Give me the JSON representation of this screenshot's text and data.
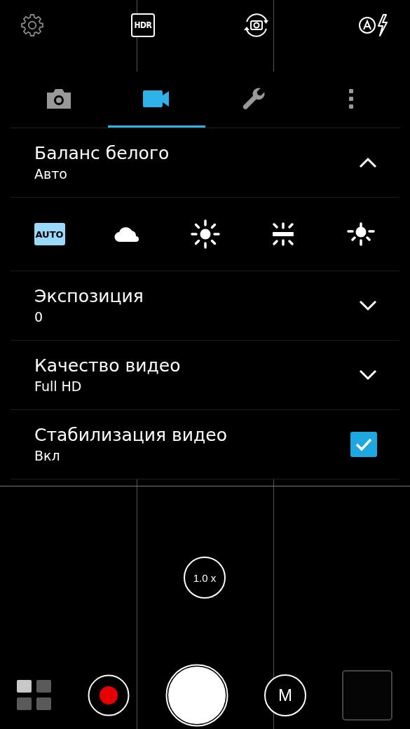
{
  "top_bar": {
    "hdr_label": "HDR"
  },
  "tabs": [
    {
      "kind": "photo",
      "selected": false
    },
    {
      "kind": "video",
      "selected": true
    },
    {
      "kind": "tools",
      "selected": false
    },
    {
      "kind": "more",
      "selected": false
    }
  ],
  "settings": [
    {
      "kind": "dropdown",
      "title": "Баланс белого",
      "value": "Авто",
      "expanded": true,
      "presets": [
        {
          "kind": "auto",
          "label": "AUTO",
          "selected": true
        },
        {
          "kind": "cloudy",
          "selected": false
        },
        {
          "kind": "sunny",
          "selected": false
        },
        {
          "kind": "fluorescent",
          "selected": false
        },
        {
          "kind": "incandescent",
          "selected": false
        }
      ]
    },
    {
      "kind": "dropdown",
      "title": "Экспозиция",
      "value": "0",
      "expanded": false
    },
    {
      "kind": "dropdown",
      "title": "Качество видео",
      "value": "Full HD",
      "expanded": false
    },
    {
      "kind": "checkbox",
      "title": "Стабилизация видео",
      "value": "Вкл",
      "checked": true
    }
  ],
  "zoom": {
    "label": "1.0 x"
  },
  "controls": {
    "mode_label": "M"
  }
}
